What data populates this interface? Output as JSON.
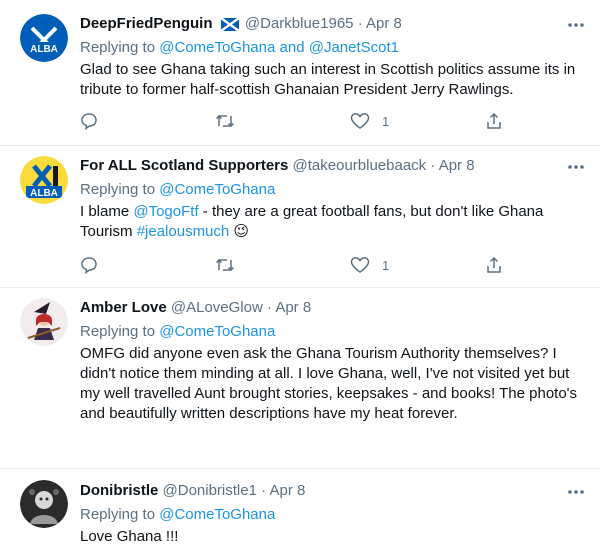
{
  "tweets": [
    {
      "display_name": "DeepFriedPenguin",
      "handle": "@Darkblue1965",
      "date": "Apr 8",
      "replying_prefix": "Replying to",
      "reply_to_1": "@ComeToGhana",
      "reply_and": "and",
      "reply_to_2": "@JanetScot1",
      "text_lines": [
        "Glad to see Ghana taking such an interest in Scottish politics assume its in",
        "tribute to former  half-scottish Ghanaian President Jerry Rawlings."
      ],
      "avatar_text": "ALBA",
      "like_count": "1"
    },
    {
      "display_name": "For ALL Scotland Supporters",
      "handle": "@takeourbluebaack",
      "date": "Apr 8",
      "replying_prefix": "Replying to",
      "reply_to_1": "@ComeToGhana",
      "text_pre": "I blame ",
      "text_mention": "@TogoFtf",
      "text_mid": " - they are a great football fans, but don't like Ghana",
      "text_line2_pre": "Tourism ",
      "text_hashtag": "#jealousmuch",
      "emoji": "😉",
      "avatar_text": "ALBA",
      "like_count": "1"
    },
    {
      "display_name": "Amber Love",
      "handle": "@ALoveGlow",
      "date": "Apr 8",
      "replying_prefix": "Replying to",
      "reply_to_1": "@ComeToGhana",
      "text_lines": [
        "OMFG did anyone even ask the Ghana Tourism Authority themselves? I",
        "didn't notice them minding at all. I love Ghana, well, I've not visited yet but",
        "my well travelled Aunt brought stories, keepsakes - and books! The photo's",
        "and beautifully written descriptions have my heat forever."
      ]
    },
    {
      "display_name": "Donibristle",
      "handle": "@Donibristle1",
      "date": "Apr 8",
      "replying_prefix": "Replying to",
      "reply_to_1": "@ComeToGhana",
      "text_lines": [
        "Love Ghana !!!"
      ]
    }
  ],
  "separator": "·",
  "icons": {
    "more": "more-horizontal-icon",
    "reply": "reply-bubble-icon",
    "retweet": "retweet-icon",
    "like": "heart-icon",
    "share": "share-icon",
    "flag": "scotland-flag-icon"
  },
  "colors": {
    "link": "#1b95e0",
    "secondary_text": "#5b7083",
    "alba_blue": "#005eb8",
    "alba_yellow": "#f7dc3c",
    "divider": "#e6ecf0"
  }
}
